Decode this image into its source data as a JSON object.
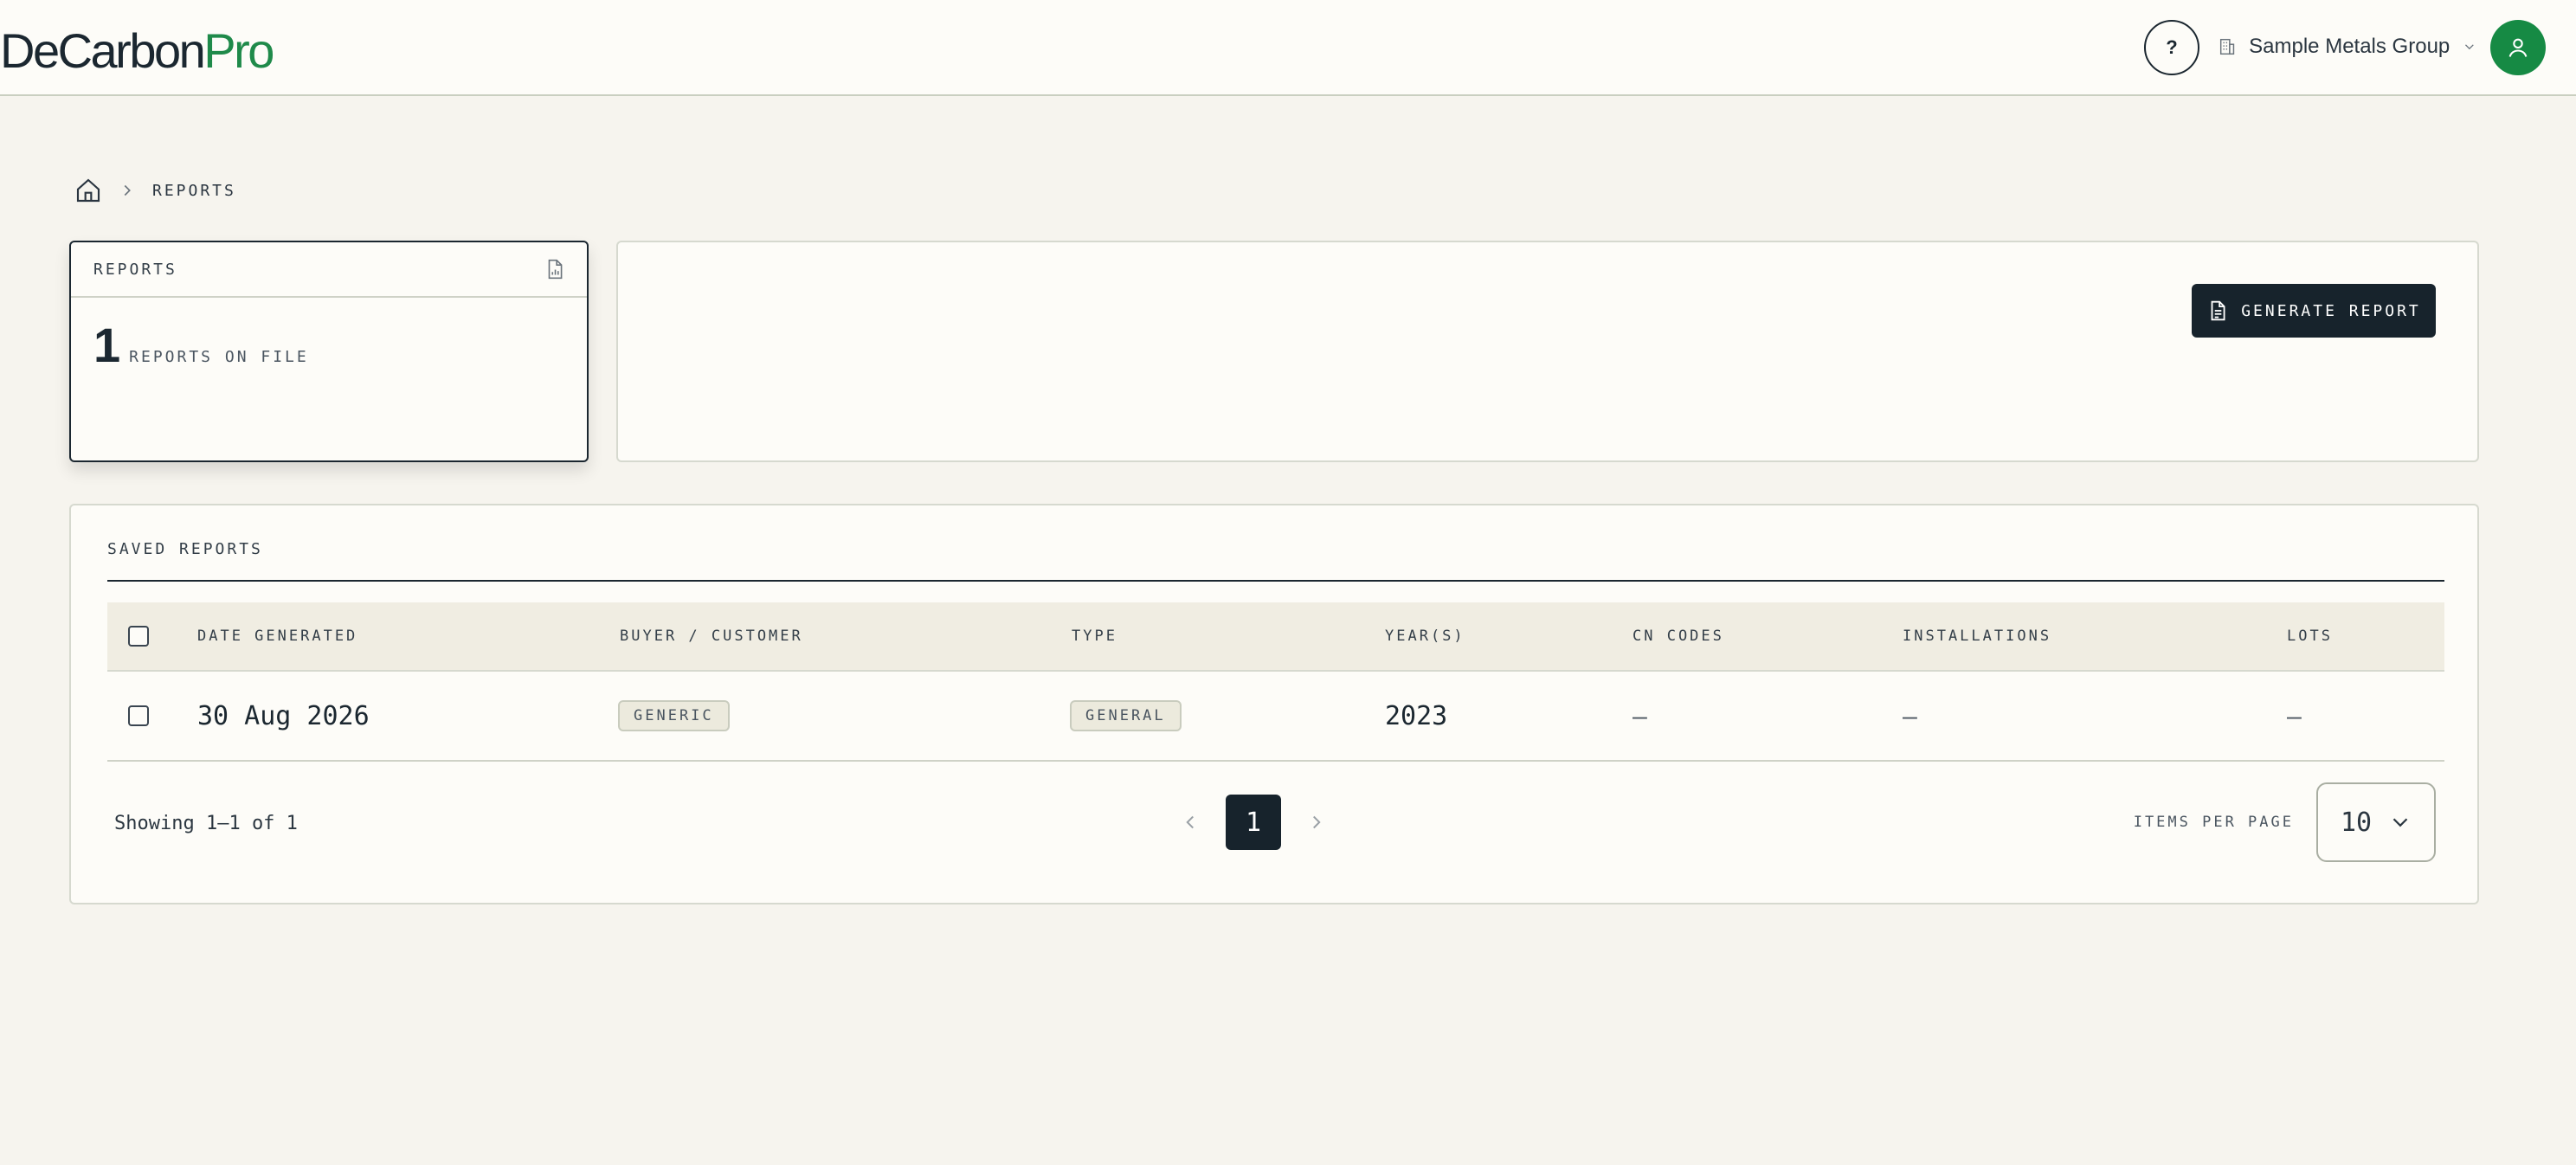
{
  "header": {
    "logo_part1": "DeCarbon",
    "logo_part2": "Pro",
    "help_label": "?",
    "org_name": "Sample Metals Group",
    "brand_color": "#1f8a4a"
  },
  "breadcrumb": {
    "current": "REPORTS"
  },
  "stat_card": {
    "title": "REPORTS",
    "count": "1",
    "subtitle": "REPORTS ON FILE"
  },
  "actions": {
    "generate_label": "GENERATE REPORT"
  },
  "saved_reports": {
    "title": "SAVED REPORTS",
    "columns": [
      "DATE GENERATED",
      "BUYER / CUSTOMER",
      "TYPE",
      "YEAR(S)",
      "CN CODES",
      "INSTALLATIONS",
      "LOTS"
    ],
    "rows": [
      {
        "date": "30 Aug 2026",
        "buyer": "GENERIC",
        "type": "GENERAL",
        "years": "2023",
        "cn_codes": "—",
        "installations": "—",
        "lots": "—"
      }
    ]
  },
  "pagination": {
    "showing": "Showing 1–1 of 1",
    "current_page": "1",
    "items_per_page_label": "ITEMS PER PAGE",
    "items_per_page": "10"
  }
}
